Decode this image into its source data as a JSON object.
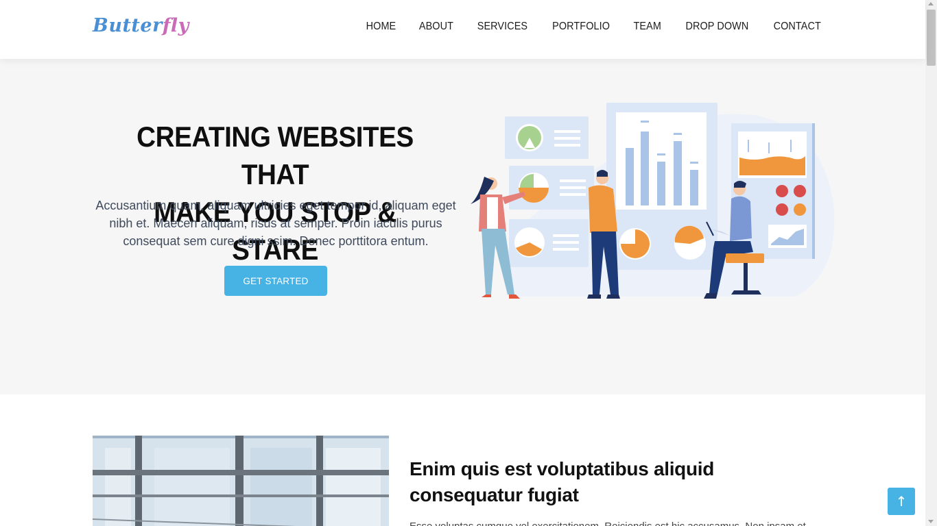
{
  "brand": {
    "logo_part1": "Butter",
    "logo_part2": "fly"
  },
  "nav": {
    "items": [
      {
        "label": "HOME"
      },
      {
        "label": "ABOUT"
      },
      {
        "label": "SERVICES"
      },
      {
        "label": "PORTFOLIO"
      },
      {
        "label": "TEAM"
      },
      {
        "label": "DROP DOWN"
      },
      {
        "label": "CONTACT"
      }
    ]
  },
  "hero": {
    "title_line1": "CREATING WEBSITES THAT",
    "title_line2": "MAKE YOU STOP & STARE",
    "text": "Accusantium quam, aliquam ultricies eget tempor id, aliquam eget nibh et. Maecen aliquam, risus at semper. Proin iaculis purus consequat sem cure digni ssim. Donec porttitora entum.",
    "cta_label": "GET STARTED",
    "illustration": "team-analytics-dashboard-illustration"
  },
  "about": {
    "title": "Enim quis est voluptatibus aliquid consequatur fugiat",
    "text": "Esse voluptas cumque vel exercitationem. Reiciendis est hic accusamus. Non ipsam et"
  },
  "back_to_top": {
    "icon": "arrow-up-icon",
    "glyph": "↑"
  },
  "colors": {
    "accent": "#47b2e4",
    "hero_bg": "#f6f6f6",
    "logo_blue": "#4a8fd3",
    "logo_pink": "#c96bb8"
  }
}
